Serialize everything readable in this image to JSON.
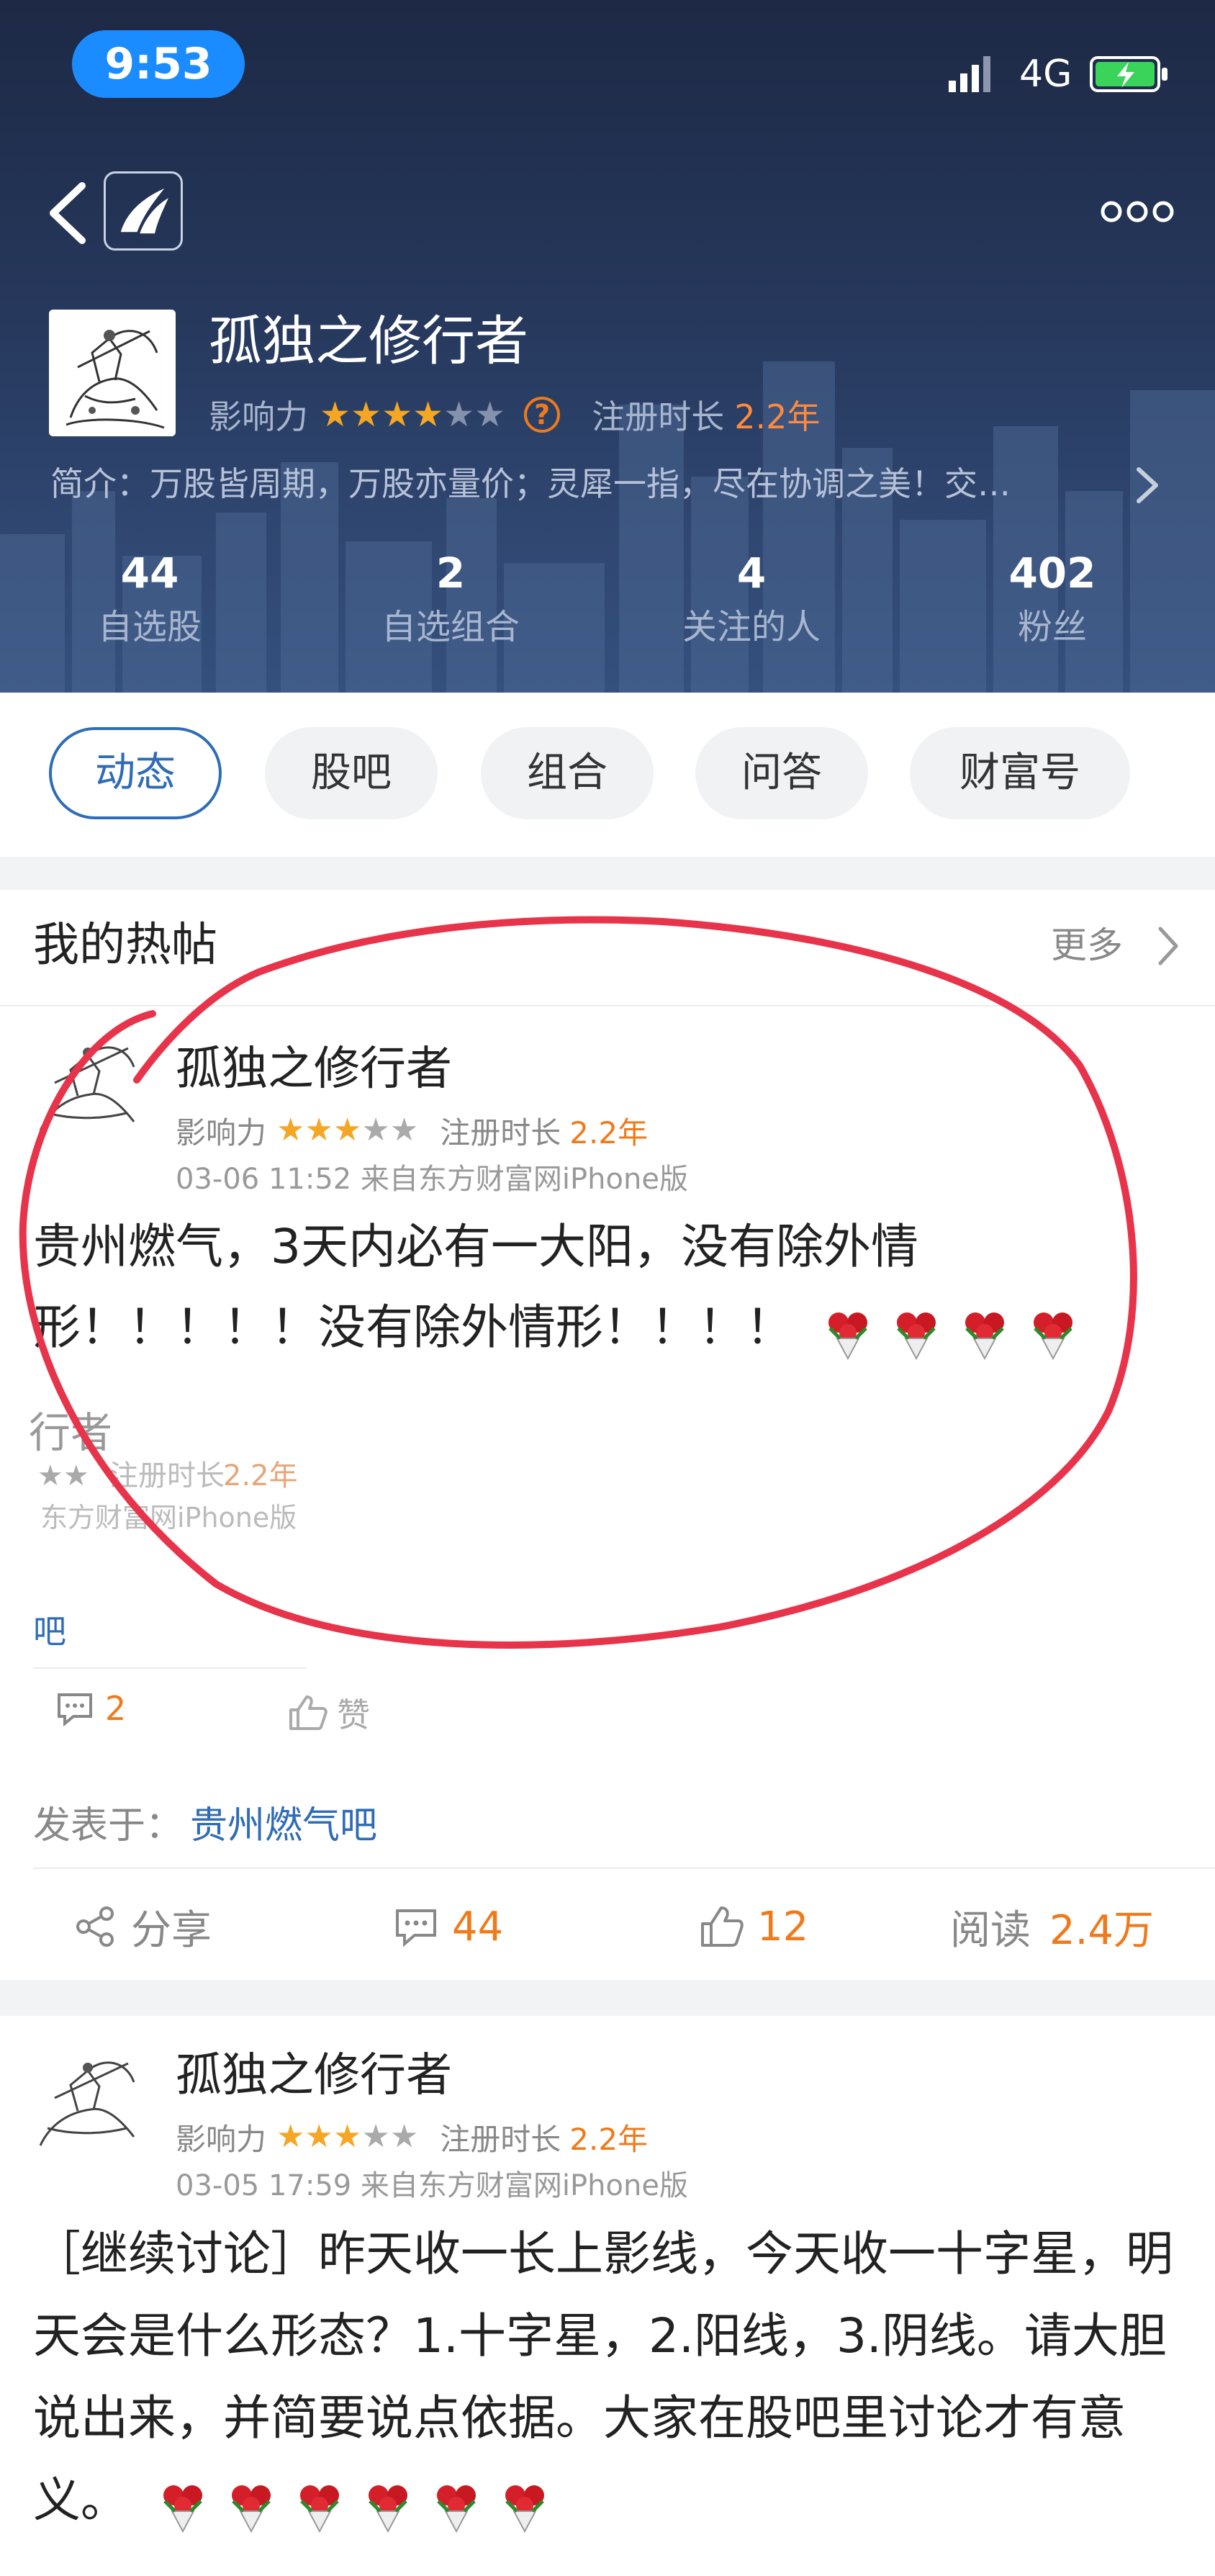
{
  "status_bar": {
    "time": "9:53",
    "network": "4G"
  },
  "profile": {
    "name": "孤独之修行者",
    "influence_label": "影响力",
    "influence_rating": 4,
    "influence_max": 5,
    "register_label": "注册时长",
    "register_value": "2.2年",
    "intro": "简介：万股皆周期，万股亦量价；灵犀一指，尽在协调之美！交…"
  },
  "stats": [
    {
      "num": "44",
      "label": "自选股"
    },
    {
      "num": "2",
      "label": "自选组合"
    },
    {
      "num": "4",
      "label": "关注的人"
    },
    {
      "num": "402",
      "label": "粉丝"
    }
  ],
  "tabs": [
    "动态",
    "股吧",
    "组合",
    "问答",
    "财富号"
  ],
  "section": {
    "title": "我的热帖",
    "more": "更多"
  },
  "posts": [
    {
      "author": "孤独之修行者",
      "influence_label": "影响力",
      "rating": 3,
      "register_label": "注册时长",
      "register_value": "2.2年",
      "time": "03-06 11:52  来自东方财富网iPhone版",
      "text": "贵州燃气，3天内必有一大阳，没有除外情形！！！！！没有除外情形！！！！",
      "flower_count": 4
    },
    {
      "author": "孤独之修行者",
      "influence_label": "影响力",
      "rating": 3,
      "register_label": "注册时长",
      "register_value": "2.2年",
      "time": "03-05 17:59  来自东方财富网iPhone版",
      "text": "［继续讨论］昨天收一长上影线，今天收一十字星，明天会是什么形态？1.十字星，2.阳线，3.阴线。请大胆说出来，并简要说点依据。大家在股吧里讨论才有意义。",
      "flower_count": 6
    }
  ],
  "overlap": {
    "name_fragment": "行者",
    "register_label": "注册时长",
    "register_value": "2.2年",
    "source_fragment": "东方财富网iPhone版",
    "bar_fragment": "吧",
    "comment_count": "2",
    "like_label": "赞"
  },
  "published": {
    "label": "发表于：",
    "bar": "贵州燃气吧"
  },
  "actions": {
    "share": "分享",
    "comments": "44",
    "likes": "12",
    "read_label": "阅读",
    "read_value": "2.4万"
  },
  "colors": {
    "accent": "#2e6cb7",
    "orange": "#f07a1a",
    "annotation": "#e8344a"
  }
}
